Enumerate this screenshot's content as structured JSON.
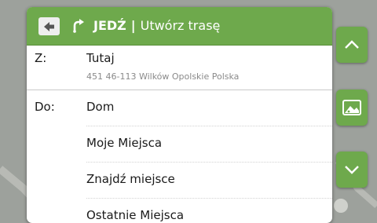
{
  "header": {
    "back_icon": "back-arrow-icon",
    "route_icon": "route-turn-icon",
    "title_bold": "JEDŹ",
    "separator": "|",
    "title": "Utwórz trasę"
  },
  "from": {
    "label": "Z:",
    "value": "Tutaj",
    "address": "451 46-113 Wilków Opolskie Polska"
  },
  "to": {
    "label": "Do:",
    "options": [
      "Dom",
      "Moje Miejsca",
      "Znajdź miejsce",
      "Ostatnie Miejsca"
    ]
  },
  "side_buttons": [
    "scroll-up-icon",
    "map-view-icon",
    "scroll-down-icon"
  ],
  "colors": {
    "accent": "#6ea94c",
    "background": "#9da19c",
    "panel": "#ffffff"
  }
}
